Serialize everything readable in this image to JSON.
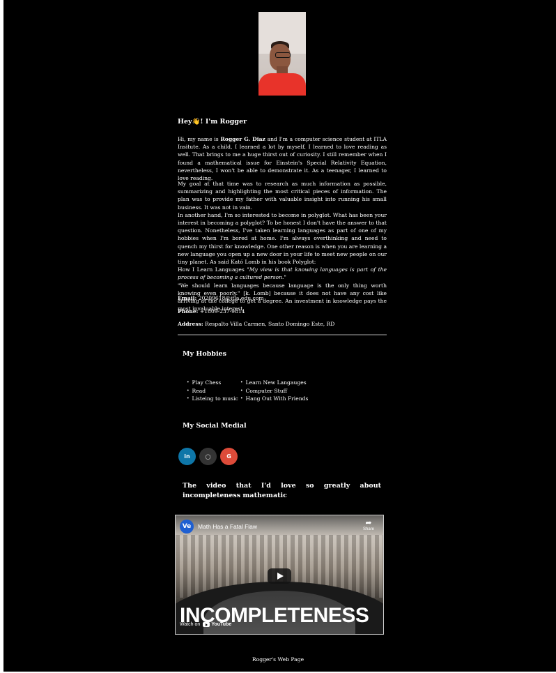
{
  "profile": {
    "greeting_title": "Hey👋! I'm Rogger",
    "p1_intro": "Hi, my name is ",
    "p1_name": "Rogger G. Diaz",
    "p1_rest": " and I'm a computer science student at ITLA Insitute. As a child, I learned a lot by myself, I learned to love reading as well. That brings to me a huge thirst out of curiosity. I still remember when I found a mathematical issue for Einstein's Special Relativity Equation, nevertheless, I won't be able to demonstrate it. As a teenager, I learned to love reading.",
    "p2_line1": "My goal at that time was to research as much information as possible, summarizing and highlighting the most critical pieces of information. The plan was to provide my father with valuable insight into running his small business. It was not in vain.",
    "p2_line2": "In another hand, I'm so interested to become in polyglot. What has been your interest in becoming a polyglot? To be honest I don't have the answer to that question. Nonetheless, I've taken learning languages as part of one of my hobbies when I'm bored at home. I'm always overthinking and need to quench my thirst for knowledge. One other reason is when you are learning a new language you open up a new door in your life to meet new people on our tiny planet. As said Kató Lomb in his book Polyglot:",
    "p2_quote_prefix": "How I Learn Languages \"",
    "p2_quote": "My view is that knowing languages is part of the process of becoming a cultured person.",
    "p2_quote_suffix": "\"",
    "p2_line4": "\"We should learn languages because language is the only thing worth knowing even poorly.\" [k. Lomb] because it does not have any cost like arriving at the college to get a degree. An investment in knowledge pays the most invaluable interest."
  },
  "contact": {
    "email_label": "Email:",
    "email_value": " 20209618@itla.edu.com",
    "phone_label": "Phone:",
    "phone_value": " +1809-237-9814",
    "address_label": "Address:",
    "address_value": " Respalto Villa Carmen, Santo Domingo Este, RD"
  },
  "hobbies": {
    "title": "My Hobbies",
    "col1": [
      "Play Chess",
      "Read",
      "Listeing to music"
    ],
    "col2": [
      "Learn New Langauges",
      "Computer Stuff",
      "Hang Out With Friends"
    ]
  },
  "social": {
    "title": "My Social Medial",
    "buttons": [
      {
        "label": "in",
        "icon": "linkedin-icon",
        "color": "#0e76a8"
      },
      {
        "label": "◯",
        "icon": "github-icon",
        "color": "#333333"
      },
      {
        "label": "G",
        "icon": "google-icon",
        "color": "#dd4b39"
      }
    ]
  },
  "video": {
    "section_title": "The video that I'd love so greatly about incompleteness mathematic",
    "channel_badge": "Ve",
    "title": "Math Has a Fatal Flaw",
    "share_label": "Share",
    "overlay_word": "INCOMPLETENESS",
    "watch_on": "Watch on",
    "youtube": "YouTube"
  },
  "footer": {
    "text": "Rogger's Web Page"
  }
}
